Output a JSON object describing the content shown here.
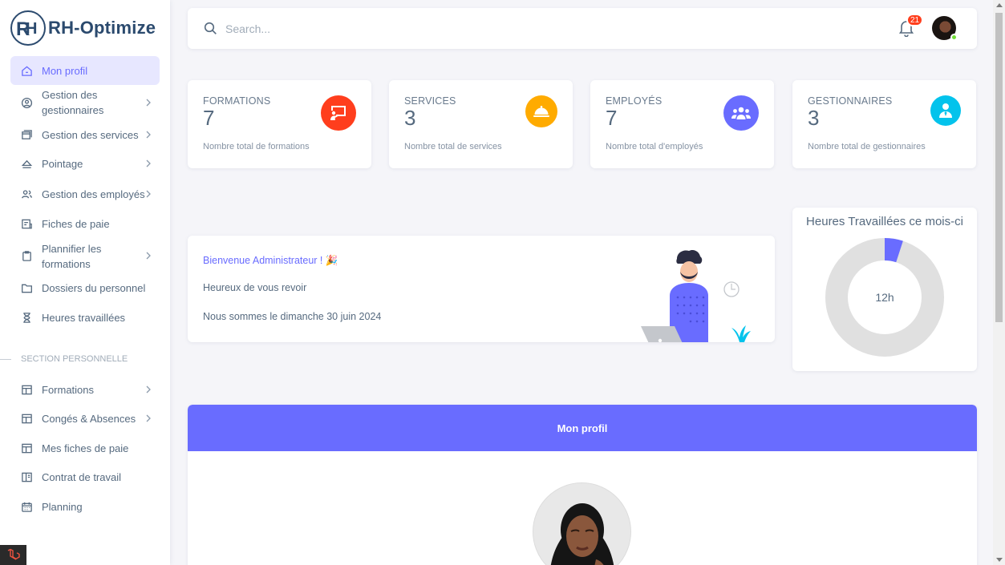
{
  "brand": {
    "name": "RH-Optimize",
    "logo_letters": "RH"
  },
  "sidebar": {
    "items": [
      {
        "label": "Mon profil",
        "icon": "home-icon",
        "active": true,
        "chevron": false
      },
      {
        "label": "Gestion des gestionnaires",
        "icon": "user-circle-icon",
        "chevron": true
      },
      {
        "label": "Gestion des services",
        "icon": "window-icon",
        "chevron": true
      },
      {
        "label": "Pointage",
        "icon": "eject-icon",
        "chevron": true
      },
      {
        "label": "Gestion des employés",
        "icon": "users-icon",
        "chevron": true
      },
      {
        "label": "Fiches de paie",
        "icon": "receipt-icon",
        "chevron": false
      },
      {
        "label": "Plannifier les formations",
        "icon": "clipboard-icon",
        "chevron": true
      },
      {
        "label": "Dossiers du personnel",
        "icon": "folder-icon",
        "chevron": false
      },
      {
        "label": "Heures travaillées",
        "icon": "hourglass-icon",
        "chevron": false
      }
    ],
    "section_title": "SECTION PERSONNELLE",
    "personal_items": [
      {
        "label": "Formations",
        "icon": "layout-icon",
        "chevron": true
      },
      {
        "label": "Congés & Absences",
        "icon": "layout-icon",
        "chevron": true
      },
      {
        "label": "Mes fiches de paie",
        "icon": "layout-icon",
        "chevron": false
      },
      {
        "label": "Contrat de travail",
        "icon": "book-icon",
        "chevron": false
      },
      {
        "label": "Planning",
        "icon": "calendar-icon",
        "chevron": false
      }
    ]
  },
  "topbar": {
    "search_placeholder": "Search...",
    "notification_count": "21"
  },
  "stats": [
    {
      "title": "FORMATIONS",
      "value": "7",
      "subtitle": "Nombre total de formations",
      "icon": "presentation-icon",
      "color": "#ff3e1d"
    },
    {
      "title": "SERVICES",
      "value": "3",
      "subtitle": "Nombre total de services",
      "icon": "service-bell-icon",
      "color": "#ffab00"
    },
    {
      "title": "EMPLOYÉS",
      "value": "7",
      "subtitle": "Nombre total d'employés",
      "icon": "group-icon",
      "color": "#696cff"
    },
    {
      "title": "GESTIONNAIRES",
      "value": "3",
      "subtitle": "Nombre total de gestionnaires",
      "icon": "manager-icon",
      "color": "#03c3ec"
    }
  ],
  "welcome": {
    "title": "Bienvenue Administrateur ! 🎉",
    "line1": "Heureux de vous revoir",
    "line2": "Nous sommes le dimanche 30 juin 2024"
  },
  "hours": {
    "title": "Heures Travaillées ce mois-ci",
    "value_label": "12h",
    "fill_fraction": 0.05,
    "color_fill": "#696cff",
    "color_track": "#e0e0e0"
  },
  "profile": {
    "header": "Mon profil"
  },
  "colors": {
    "primary": "#696cff",
    "danger": "#ff3e1d",
    "warning": "#ffab00",
    "info": "#03c3ec",
    "online": "#71dd37"
  }
}
